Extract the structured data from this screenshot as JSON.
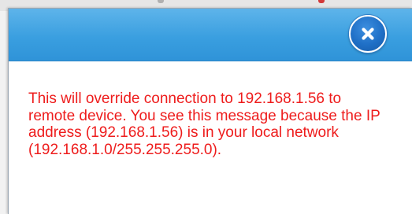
{
  "dialog": {
    "message": "This will override connection to 192.168.1.56 to remote device. You see this message because the IP address (192.168.1.56) is in your local network (192.168.1.0/255.255.255.0).",
    "close_icon": "close-icon"
  },
  "colors": {
    "header_blue": "#3a9fe0",
    "message_red": "#ee1c1c",
    "close_button_blue": "#1f6fc6"
  }
}
